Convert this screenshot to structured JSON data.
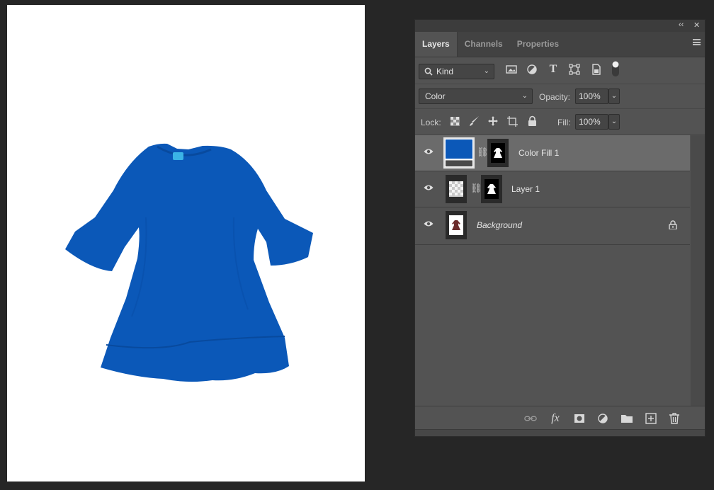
{
  "document": {
    "garment_color": "#0b58b8",
    "background": "#ffffff"
  },
  "panel": {
    "window_controls": {
      "collapse": "‹‹",
      "close": "✕"
    },
    "tabs": [
      {
        "label": "Layers",
        "active": true
      },
      {
        "label": "Channels",
        "active": false
      },
      {
        "label": "Properties",
        "active": false
      }
    ],
    "filter": {
      "label": "Kind",
      "icons": [
        "image-filter-icon",
        "adjustment-filter-icon",
        "type-filter-icon",
        "shape-filter-icon",
        "smart-object-filter-icon"
      ]
    },
    "blend_mode": "Color",
    "opacity_label": "Opacity:",
    "opacity_value": "100%",
    "lock_label": "Lock:",
    "fill_label": "Fill:",
    "fill_value": "100%",
    "layers": [
      {
        "name": "Color Fill 1",
        "selected": true,
        "italic": false,
        "locked": false
      },
      {
        "name": "Layer 1",
        "selected": false,
        "italic": false,
        "locked": false
      },
      {
        "name": "Background",
        "selected": false,
        "italic": true,
        "locked": true
      }
    ],
    "bottom_icons": [
      "link-layers-icon",
      "fx-icon",
      "add-mask-icon",
      "adjustment-layer-icon",
      "group-folder-icon",
      "new-layer-icon",
      "trash-icon"
    ],
    "fx_label": "fx"
  }
}
